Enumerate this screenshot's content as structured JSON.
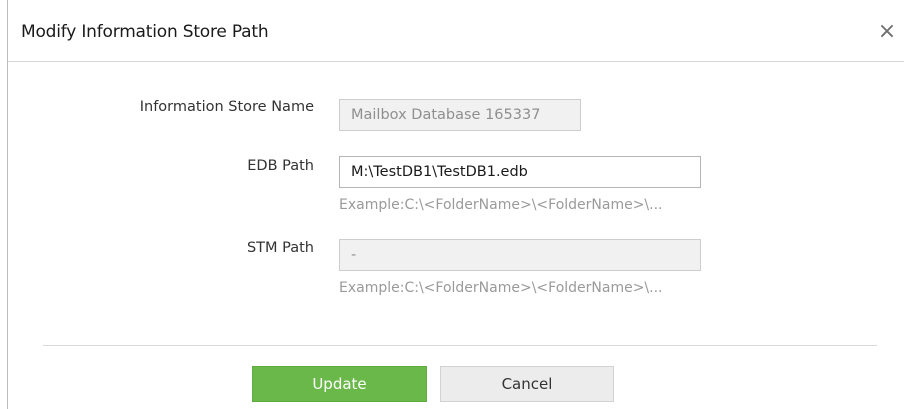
{
  "dialog": {
    "title": "Modify Information Store Path",
    "close_glyph": "×",
    "close_icon": "close-icon"
  },
  "form": {
    "store_name": {
      "label": "Information Store Name",
      "value": "Mailbox Database 165337"
    },
    "edb_path": {
      "label": "EDB Path",
      "value": "M:\\TestDB1\\TestDB1.edb",
      "hint": "Example:C:\\<FolderName>\\<FolderName>\\..."
    },
    "stm_path": {
      "label": "STM Path",
      "value": "-",
      "hint": "Example:C:\\<FolderName>\\<FolderName>\\..."
    }
  },
  "buttons": {
    "update_label": "Update",
    "cancel_label": "Cancel"
  },
  "colors": {
    "update_button": "#6ab84a",
    "cancel_button": "#ececec"
  }
}
